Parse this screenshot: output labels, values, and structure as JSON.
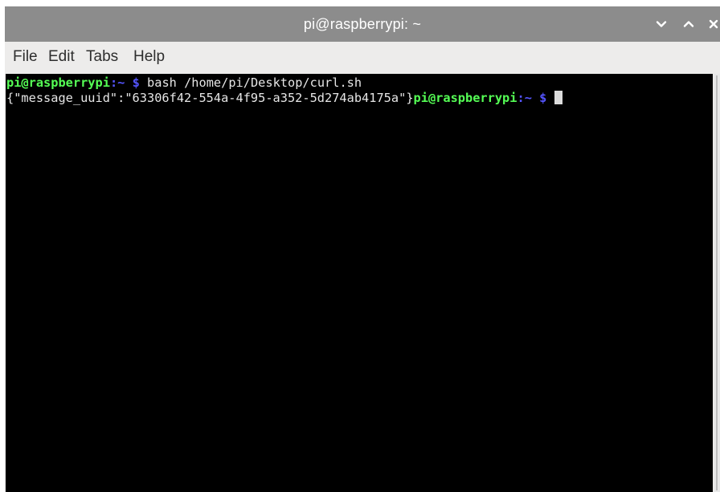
{
  "window": {
    "title": "pi@raspberrypi: ~"
  },
  "menu": {
    "items": [
      "File",
      "Edit",
      "Tabs",
      "Help"
    ]
  },
  "terminal": {
    "line1": {
      "user_host": "pi@raspberrypi",
      "sep": ":",
      "path": "~",
      "dollar": "$",
      "command": " bash /home/pi/Desktop/curl.sh"
    },
    "line2": {
      "output": "{\"message_uuid\":\"63306f42-554a-4f95-a352-5d274ab4175a\"}",
      "user_host": "pi@raspberrypi",
      "sep": ":",
      "path": "~",
      "dollar": "$"
    }
  },
  "colors": {
    "titlebar": "#8c8c8c",
    "menubar": "#edeceb",
    "terminal_bg": "#000000",
    "prompt_user": "#55ff55",
    "prompt_path": "#5555ff"
  },
  "icons": {
    "minimize": "chevron-down-icon",
    "maximize": "chevron-up-icon",
    "close": "close-icon"
  }
}
